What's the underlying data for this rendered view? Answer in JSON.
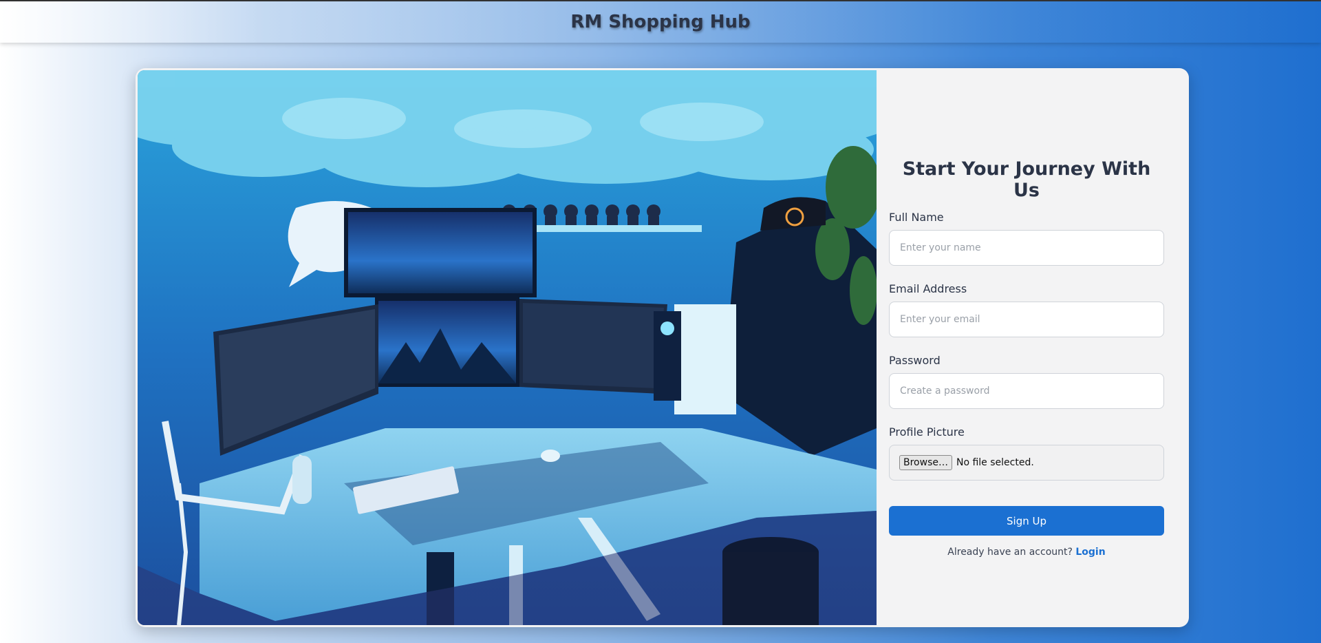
{
  "header": {
    "title": "RM Shopping Hub"
  },
  "hero": {
    "image_alt": "Gaming desk setup with blue lighting"
  },
  "form": {
    "title": "Start Your Journey With Us",
    "full_name": {
      "label": "Full Name",
      "placeholder": "Enter your name"
    },
    "email": {
      "label": "Email Address",
      "placeholder": "Enter your email"
    },
    "password": {
      "label": "Password",
      "placeholder": "Create a password"
    },
    "profile_picture": {
      "label": "Profile Picture",
      "browse_label": "Browse…",
      "status": "No file selected."
    },
    "submit_label": "Sign Up",
    "login_prompt": "Already have an account?",
    "login_link": "Login"
  },
  "colors": {
    "accent": "#1b70d2",
    "heading": "#2b3447",
    "panel_bg": "#f3f3f4"
  }
}
